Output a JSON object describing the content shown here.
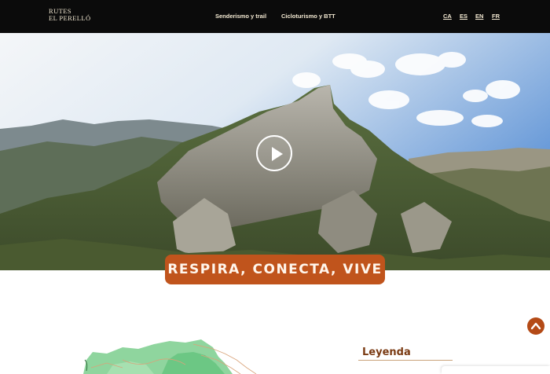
{
  "header": {
    "logo_line1": "RUTES",
    "logo_line2": "EL PERELLÓ",
    "nav": [
      {
        "label": "Senderismo y trail"
      },
      {
        "label": "Cicloturismo y BTT"
      }
    ],
    "languages": [
      "CA",
      "ES",
      "EN",
      "FR"
    ]
  },
  "hero": {
    "slogan": "RESPIRA, CONECTA, VIVE",
    "play_icon": "play-icon"
  },
  "legend": {
    "title": "Leyenda"
  },
  "colors": {
    "topbar": "#0b0b0b",
    "accent": "#c0541c",
    "accent_dark": "#b44a16",
    "legend_title": "#7a3a12"
  }
}
